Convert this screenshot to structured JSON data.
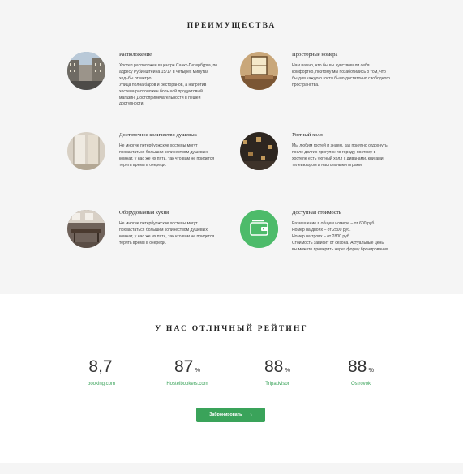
{
  "features": {
    "title": "Преимущества",
    "items": [
      {
        "title": "Расположение",
        "description": "Хостел расположен в центре Санкт-Петербурга, по\nадресу Рубинштейна 15/17 в четырех минутах\nходьбы от метро.\nУлица полна баров и ресторанов, а напротив\nхостела расположен большой продуктовый\nмагазин. Достопримечательности в пешей\nдоступности.",
        "image": "street-photo"
      },
      {
        "title": "Просторные номера",
        "description": "Нам важно, что бы вы чувствовали себя\nкомфортно, поэтому мы позаботились о том, что\nбы для каждого гостя было достаточно свободного\nпространства.",
        "image": "room-photo"
      },
      {
        "title": "Достаточное количество душевых",
        "description": "Не многие петербуржские хостелы могут\nпохвастаться большим количеством душевых\nкомнат, у нас же их пять, так что вам не придется\nтерять время в очереди.",
        "image": "shower-photo"
      },
      {
        "title": "Уютный холл",
        "description": "Мы любим гостей и знаем, как приятно отдохнуть\nпосле долгих прогулок по городу, поэтому в\nхостеле есть уютный холл с диванами, книгами,\nтелевизором и настольными играми.",
        "image": "hall-photo"
      },
      {
        "title": "Оборудованная кухня",
        "description": "Не многие петербуржские хостелы могут\nпохвастаться большим количеством душевых\nкомнат, у нас же их пять, так что вам не придется\nтерять время в очереди.",
        "image": "kitchen-photo"
      },
      {
        "title": "Доступная стоимость",
        "description": "Размещение в общем номере – от 600 руб.\nНомер на двоих – от 2500 руб.\nНомер на троих – от 2800 руб.\nСтоимость зависит от сезона. Актуальные цены\nвы можете проверить через форму бронирования",
        "image": "wallet-icon"
      }
    ]
  },
  "ratings": {
    "title": "У нас отличный рейтинг",
    "items": [
      {
        "score": "8,7",
        "unit": "",
        "site": "booking.com"
      },
      {
        "score": "87",
        "unit": "%",
        "site": "Hostelbookers.com"
      },
      {
        "score": "88",
        "unit": "%",
        "site": "Tripadvisor"
      },
      {
        "score": "88",
        "unit": "%",
        "site": "Ostrovok"
      }
    ],
    "button_label": "Забронировать"
  },
  "colors": {
    "accent": "#3aa35a",
    "section_bg": "#f5f5f5"
  }
}
